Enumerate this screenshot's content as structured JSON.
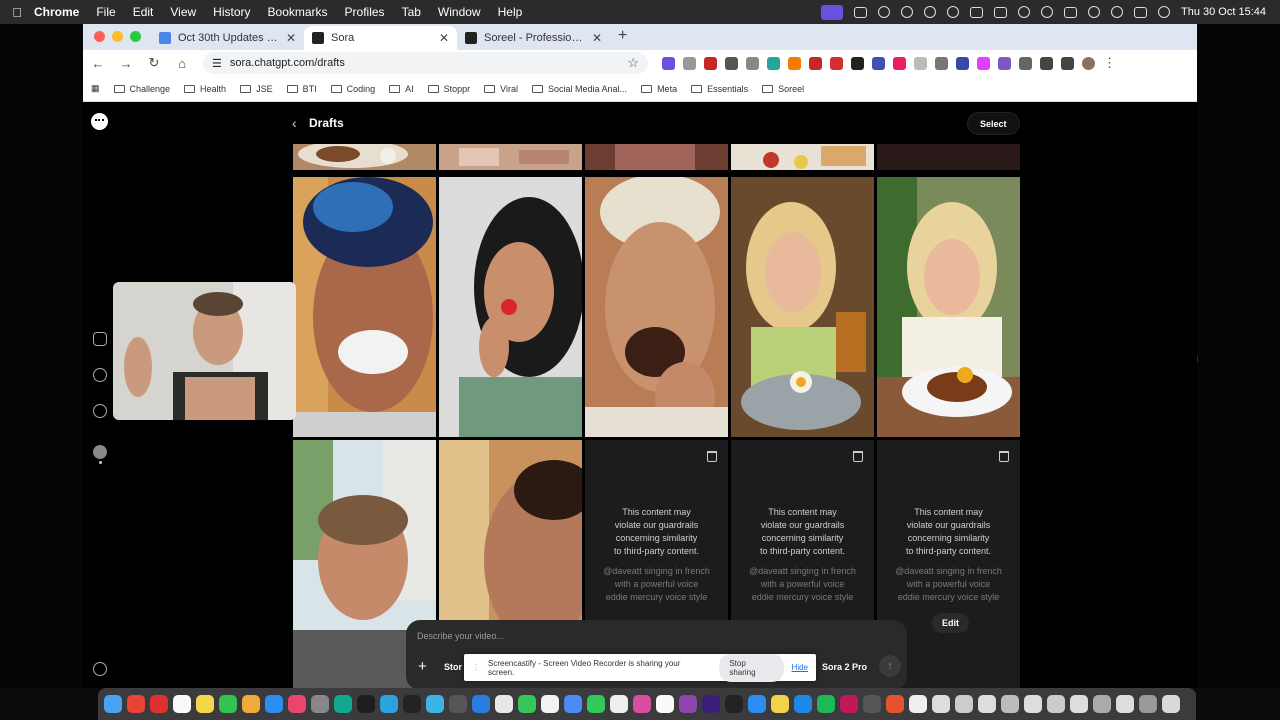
{
  "menubar": {
    "app": "Chrome",
    "items": [
      "File",
      "Edit",
      "View",
      "History",
      "Bookmarks",
      "Profiles",
      "Tab",
      "Window",
      "Help"
    ],
    "clock": "Thu 30 Oct  15:44"
  },
  "tabs": [
    {
      "title": "Oct 30th Updates - Google D",
      "fav_color": "#4a86e8"
    },
    {
      "title": "Sora",
      "fav_color": "#222222"
    },
    {
      "title": "Soreel - Professional AI Video",
      "fav_color": "#222222"
    }
  ],
  "address": "sora.chatgpt.com/drafts",
  "bookmarks": [
    "Challenge",
    "Health",
    "JSE",
    "BTI",
    "Coding",
    "AI",
    "Stoppr",
    "Viral",
    "Social Media Anal...",
    "Meta",
    "Essentials",
    "Soreel"
  ],
  "page": {
    "title": "Drafts",
    "select_label": "Select",
    "blocked_message": "This content may\nviolate our guardrails\nconcerning similarity\nto third-party content.",
    "blocked_prompt": "@daveatt singing in french\nwith a powerful voice\neddie mercury voice style",
    "edit_label": "Edit"
  },
  "composer": {
    "placeholder": "Describe your video...",
    "story_label": "Stor",
    "model_label": "Sora 2 Pro"
  },
  "sharebar": {
    "text": "Screencastify - Screen Video Recorder is sharing your screen.",
    "stop_label": "Stop sharing",
    "hide_label": "Hide"
  }
}
